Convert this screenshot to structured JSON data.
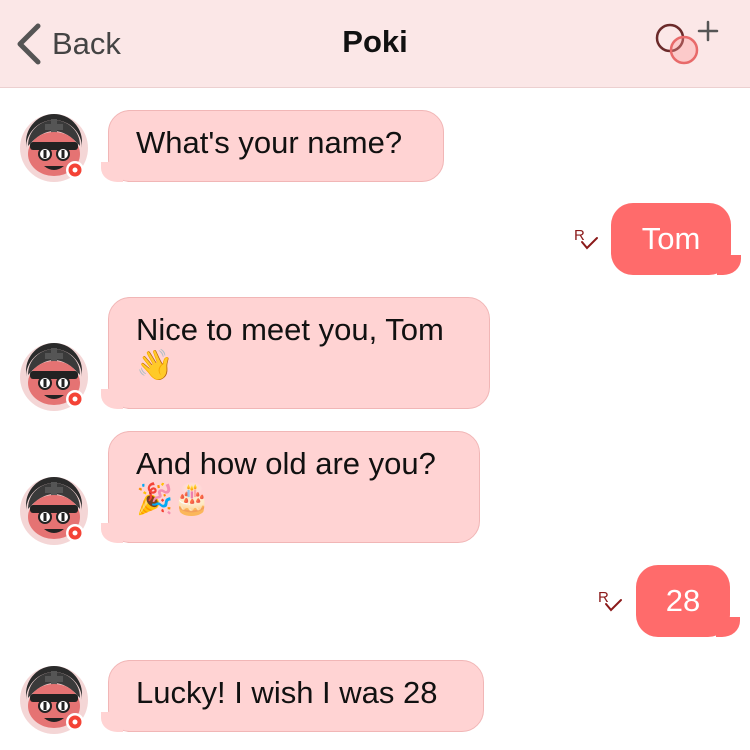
{
  "header": {
    "back_label": "Back",
    "title": "Poki",
    "add_icon": "add-group-icon"
  },
  "messages": [
    {
      "from": "bot",
      "text": "What's your name?"
    },
    {
      "from": "user",
      "text": "Tom",
      "status": "read"
    },
    {
      "from": "bot",
      "text": "Nice to meet you, Tom",
      "emoji": "👋"
    },
    {
      "from": "bot",
      "text": "And how old are you?",
      "emoji": "🎉🎂"
    },
    {
      "from": "user",
      "text": "28",
      "status": "read"
    },
    {
      "from": "bot",
      "text": "Lucky! I wish I was 28"
    }
  ],
  "colors": {
    "header_bg": "#fbe7e7",
    "incoming_bubble": "#ffd3d3",
    "outgoing_bubble": "#ff6b6b",
    "read_receipt": "#8b1a1a"
  }
}
